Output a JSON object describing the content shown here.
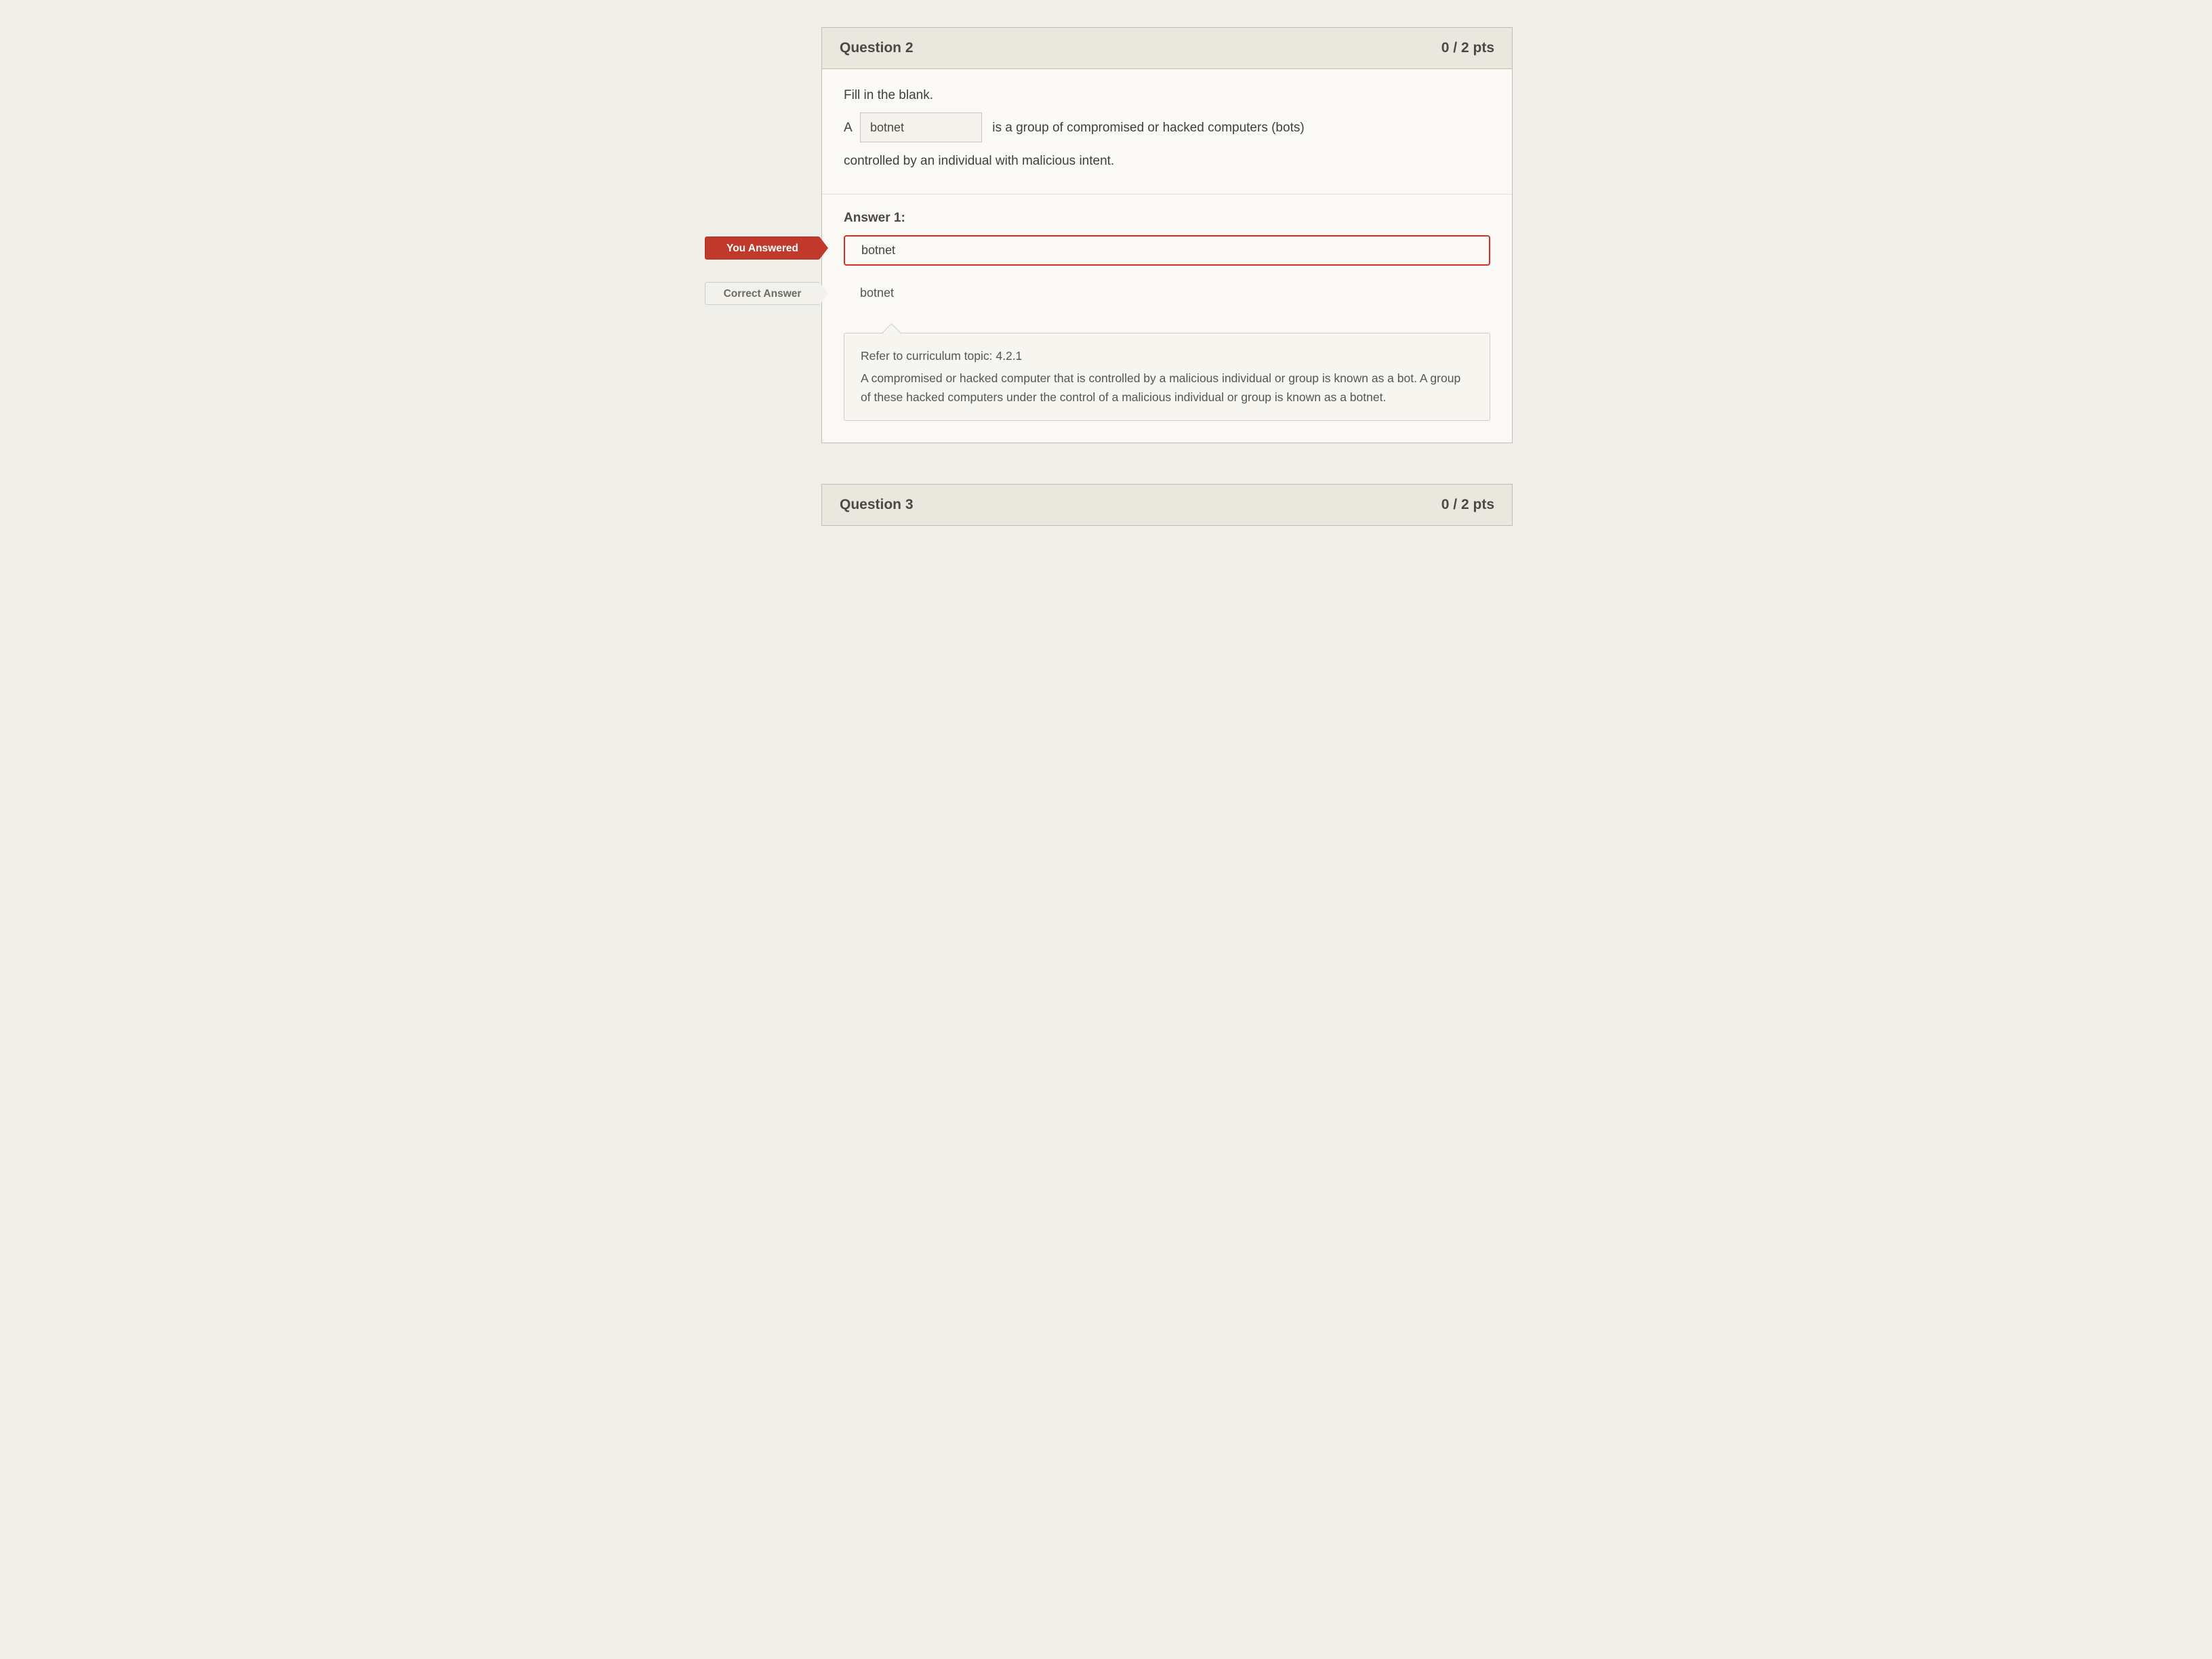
{
  "question2": {
    "title": "Question 2",
    "points": "0 / 2 pts",
    "intro": "Fill in the blank.",
    "letter": "A",
    "blank_value": "botnet",
    "sentence_after_blank": "is a group of compromised or hacked computers (bots)",
    "sentence_line2": "controlled by an individual with malicious intent.",
    "answer_heading": "Answer 1:",
    "you_answered_label": "You Answered",
    "your_answer": "botnet",
    "correct_label": "Correct Answer",
    "correct_answer": "botnet",
    "feedback_ref": "Refer to curriculum topic: 4.2.1",
    "feedback_body": "A compromised or hacked computer that is controlled by a malicious individual or group is known as a bot. A group of these hacked computers under the control of a malicious individual or group is known as a botnet."
  },
  "question3": {
    "title": "Question 3",
    "points": "0 / 2 pts"
  }
}
